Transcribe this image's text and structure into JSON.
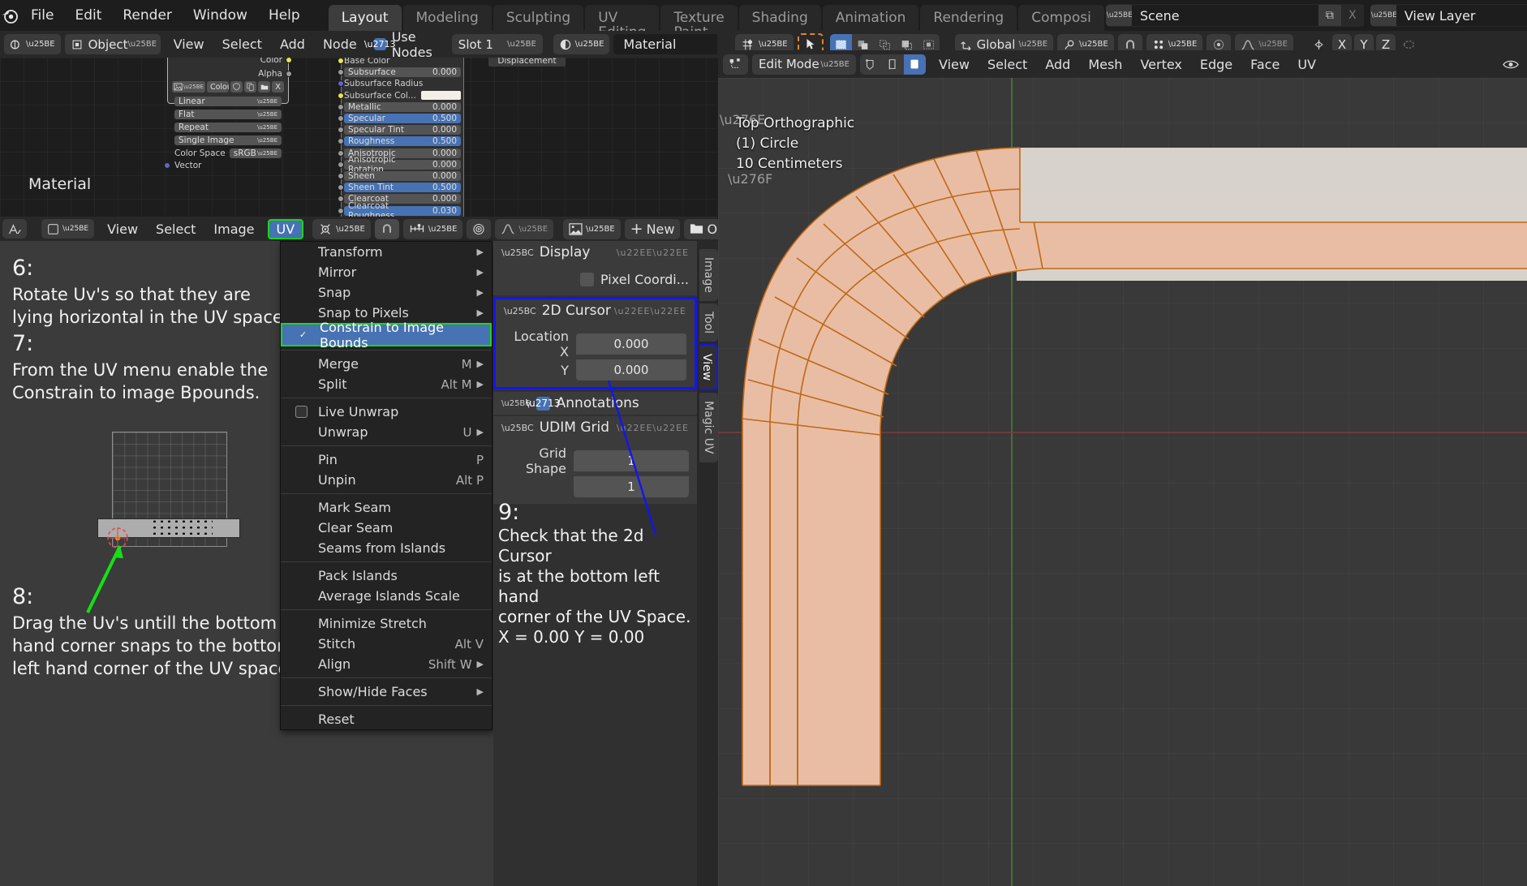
{
  "app": {
    "name": "Blender"
  },
  "topbar": {
    "menus": [
      "File",
      "Edit",
      "Render",
      "Window",
      "Help"
    ],
    "workspaces": [
      {
        "label": "Layout",
        "active": true
      },
      {
        "label": "Modeling",
        "active": false
      },
      {
        "label": "Sculpting",
        "active": false
      },
      {
        "label": "UV Editing",
        "active": false
      },
      {
        "label": "Texture Paint",
        "active": false
      },
      {
        "label": "Shading",
        "active": false
      },
      {
        "label": "Animation",
        "active": false
      },
      {
        "label": "Rendering",
        "active": false
      },
      {
        "label": "Composi",
        "active": false
      }
    ],
    "scene": {
      "label": "Scene",
      "new_btn": "⧉",
      "x_btn": "X"
    },
    "view_layer": {
      "label": "View Layer",
      "new_btn": "⧉",
      "x_btn": "X"
    }
  },
  "shader_header": {
    "editor_type": "shader-editor-icon",
    "shader_type": "Object",
    "menus": [
      "View",
      "Select",
      "Add",
      "Node"
    ],
    "use_nodes_label": "Use Nodes",
    "use_nodes_checked": true,
    "slot": "Slot 1",
    "material": "Material",
    "pin_icon": "shield-icon",
    "copy_icon": "duplicate-icon",
    "close_icon": "X"
  },
  "viewport_header_right": {
    "snap_dropdown": "magnet-icon",
    "select_tool": "cursor-icon",
    "select_modes": [
      "set",
      "extend",
      "subtract",
      "invert",
      "intersect"
    ],
    "transform_orientation": "Global",
    "pivot": "pivot-icon",
    "snap": "magnet-icon",
    "proportional": "proportional-icon",
    "axes": [
      "X",
      "Y",
      "Z"
    ]
  },
  "node_editor": {
    "material_label": "Material",
    "image_node": {
      "outputs": [
        "Color",
        "Alpha"
      ],
      "image_name": "Colour grid arrow...",
      "interpolation": "Linear",
      "projection": "Flat",
      "extension": "Repeat",
      "source": "Single Image",
      "color_space_label": "Color Space",
      "color_space": "sRGB",
      "input": "Vector",
      "buttons": [
        "shield-icon",
        "duplicate-icon",
        "folder-icon",
        "X"
      ]
    },
    "bsdf_node": {
      "displacement_label": "Displacement",
      "rows": [
        {
          "name": "Base Color",
          "value": "",
          "socket": "yellow",
          "highlight": false,
          "plain": true
        },
        {
          "name": "Subsurface",
          "value": "0.000",
          "socket": "grey",
          "highlight": false
        },
        {
          "name": "Subsurface Radius",
          "value": "",
          "socket": "purple",
          "highlight": false,
          "plain": true
        },
        {
          "name": "Subsurface Col...",
          "value": "",
          "socket": "yellow",
          "highlight": false,
          "plain": true,
          "swatch": true
        },
        {
          "name": "Metallic",
          "value": "0.000",
          "socket": "grey",
          "highlight": false
        },
        {
          "name": "Specular",
          "value": "0.500",
          "socket": "grey",
          "highlight": true
        },
        {
          "name": "Specular Tint",
          "value": "0.000",
          "socket": "grey",
          "highlight": false
        },
        {
          "name": "Roughness",
          "value": "0.500",
          "socket": "grey",
          "highlight": true
        },
        {
          "name": "Anisotropic",
          "value": "0.000",
          "socket": "grey",
          "highlight": false
        },
        {
          "name": "Anisotropic Rotation",
          "value": "0.000",
          "socket": "grey",
          "highlight": false
        },
        {
          "name": "Sheen",
          "value": "0.000",
          "socket": "grey",
          "highlight": false
        },
        {
          "name": "Sheen Tint",
          "value": "0.500",
          "socket": "grey",
          "highlight": true
        },
        {
          "name": "Clearcoat",
          "value": "0.000",
          "socket": "grey",
          "highlight": false
        },
        {
          "name": "Clearcoat Roughness",
          "value": "0.030",
          "socket": "grey",
          "highlight": true
        }
      ]
    }
  },
  "uv_header": {
    "editor_icon": "uv-editor-icon",
    "display_modes": [
      "view",
      "paint",
      "mask",
      "stencil"
    ],
    "mode_dropdown": "uv-mode-icon",
    "menus": [
      "View",
      "Select",
      "Image"
    ],
    "uv_menu_label": "UV",
    "pivot_icon": "pivot-icon",
    "snap_icon": "magnet-icon",
    "snap_target_icon": "snap-target-icon",
    "proportional_icon": "proportional-icon",
    "image_selector_icon": "image-icon",
    "new_label": "New",
    "open_label": "Open",
    "pin_icon": "pin-icon",
    "overlay_icon": "overlay-icon"
  },
  "uv_menu": {
    "items": [
      {
        "label": "Transform",
        "accel": "T",
        "submenu": true
      },
      {
        "label": "Mirror",
        "accel": "M",
        "submenu": true
      },
      {
        "label": "Snap",
        "accel": "S",
        "submenu": true
      },
      {
        "label": "Snap to Pixels",
        "accel": "P",
        "submenu": true
      },
      {
        "label": "Constrain to Image Bounds",
        "checkbox": true,
        "checked": true,
        "selected": true
      },
      {
        "separator": true
      },
      {
        "label": "Merge",
        "shortcut": "M",
        "submenu": true
      },
      {
        "label": "Split",
        "shortcut": "Alt M",
        "submenu": true
      },
      {
        "separator": true
      },
      {
        "label": "Live Unwrap",
        "checkbox": true,
        "checked": false
      },
      {
        "label": "Unwrap",
        "shortcut": "U",
        "submenu": true
      },
      {
        "separator": true
      },
      {
        "label": "Pin",
        "shortcut": "P"
      },
      {
        "label": "Unpin",
        "shortcut": "Alt P"
      },
      {
        "separator": true
      },
      {
        "label": "Mark Seam"
      },
      {
        "label": "Clear Seam"
      },
      {
        "label": "Seams from Islands"
      },
      {
        "separator": true
      },
      {
        "label": "Pack Islands"
      },
      {
        "label": "Average Islands Scale"
      },
      {
        "separator": true
      },
      {
        "label": "Minimize Stretch"
      },
      {
        "label": "Stitch",
        "shortcut": "Alt V"
      },
      {
        "label": "Align",
        "shortcut": "Shift W",
        "submenu": true
      },
      {
        "separator": true
      },
      {
        "label": "Show/Hide Faces",
        "submenu": true
      },
      {
        "separator": true
      },
      {
        "label": "Reset"
      }
    ]
  },
  "sidebar": {
    "panels": {
      "display": {
        "title": "Display",
        "pixel_coords_label": "Pixel Coordi...",
        "pixel_coords_checked": false
      },
      "cursor_2d": {
        "title": "2D Cursor",
        "location_x_label": "Location X",
        "location_x_value": "0.000",
        "location_y_label": "Y",
        "location_y_value": "0.000"
      },
      "annotations": {
        "title": "Annotations",
        "checked": true
      },
      "udim": {
        "title": "UDIM Grid",
        "grid_shape_label": "Grid Shape",
        "grid_shape_x": "1",
        "grid_shape_y": "1"
      }
    },
    "tabs": [
      {
        "label": "Image",
        "active": false
      },
      {
        "label": "Tool",
        "active": false
      },
      {
        "label": "View",
        "active": true
      },
      {
        "label": "Magic UV",
        "active": false
      }
    ]
  },
  "instructions": [
    {
      "num": "6:",
      "text": "Rotate Uv's so that they are\nlying horizontal in the UV space."
    },
    {
      "num": "7:",
      "text": "From the UV menu enable the\nConstrain to image Bpounds."
    },
    {
      "num": "8:",
      "text": "Drag the Uv's untill the bottom left\nhand corner snaps to the bottom\nleft hand corner of the UV space."
    },
    {
      "num": "9:",
      "text": "Check that the 2d Cursor\nis at the bottom left hand\ncorner of the UV Space.\nX = 0.00   Y = 0.00"
    }
  ],
  "viewport": {
    "mode": "Edit Mode",
    "mesh_select_modes": [
      "vertex",
      "edge",
      "face"
    ],
    "active_select_mode": "face",
    "menus": [
      "View",
      "Select",
      "Add",
      "Mesh",
      "Vertex",
      "Edge",
      "Face",
      "UV"
    ],
    "overlay_text": [
      "Top Orthographic",
      "(1) Circle",
      "10 Centimeters"
    ],
    "mesh_color": "#e8bda4",
    "edge_color": "#c06818"
  },
  "colors": {
    "accent_blue": "#4772b3",
    "highlight_green": "#1bd61b",
    "highlight_blue": "#1414f0",
    "bg_dark": "#1d1d1d",
    "bg_panel": "#303030",
    "bg_header": "#282828",
    "bg_editor": "#3b3b3b"
  }
}
